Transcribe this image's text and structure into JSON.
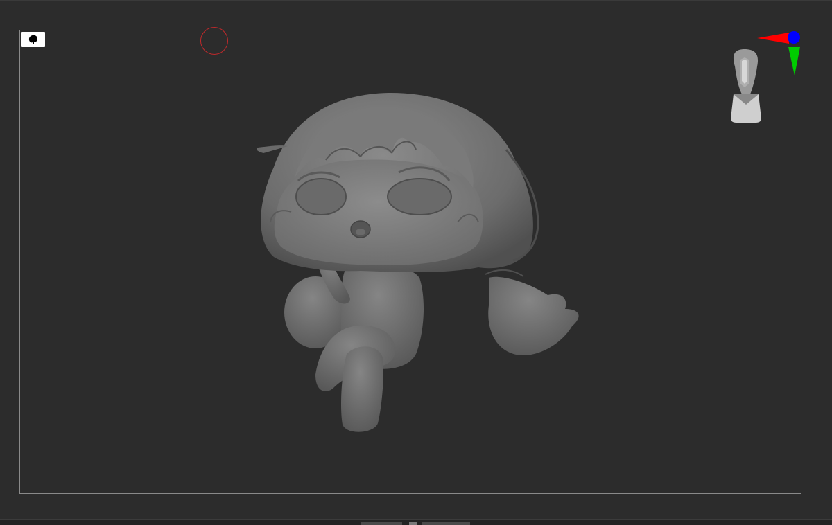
{
  "viewport": {
    "background_color": "#2c2c2c",
    "frame_color": "#8a8a8a",
    "model_color": "#767676"
  },
  "thumbnail": {
    "icon": "model-silhouette-icon",
    "background_color": "#ffffff"
  },
  "brush_cursor": {
    "icon": "brush-circle",
    "color": "#c0292b"
  },
  "orientation_gizmo": {
    "head_icon": "orientation-head-icon",
    "x_axis_color": "#ff0000",
    "y_axis_color": "#00cc00",
    "z_axis_color": "#0000ff"
  }
}
